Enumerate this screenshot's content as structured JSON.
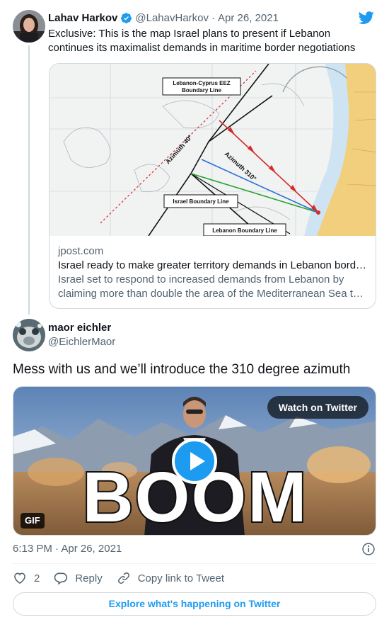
{
  "quoted_tweet": {
    "display_name": "Lahav Harkov",
    "handle": "@LahavHarkov",
    "separator": "·",
    "date": "Apr 26, 2021",
    "text": "Exclusive: This is the map Israel plans to present if Lebanon continues its maximalist demands in maritime border negotiations",
    "link_card": {
      "domain": "jpost.com",
      "title": "Israel ready to make greater territory demands in Lebanon bord…",
      "description": "Israel set to respond to increased demands from Lebanon by claiming more than double the area of the Mediterranean Sea t…",
      "map_labels": {
        "eez": [
          "Lebanon-Cyprus EEZ",
          "Boundary Line"
        ],
        "azimuth_40": "Azimuth 40°",
        "azimuth_310": "Azimuth 310°",
        "israel_line": "Israel Boundary Line",
        "lebanon_line": "Lebanon Boundary Line"
      }
    }
  },
  "main_tweet": {
    "display_name": "maor eichler",
    "handle": "@EichlerMaor",
    "text": "Mess with us and we’ll introduce the 310 degree azimuth",
    "media": {
      "watch_label": "Watch on Twitter",
      "gif_label": "GIF",
      "overlay_text": "BOOM"
    },
    "timestamp": "6:13 PM · Apr 26, 2021"
  },
  "actions": {
    "like_count": "2",
    "reply_label": "Reply",
    "copy_label": "Copy link to Tweet"
  },
  "explore_label": "Explore what's happening on Twitter",
  "icons": {
    "brand": "twitter-bird-icon",
    "verified": "verified-badge-icon",
    "info": "info-icon",
    "like": "heart-icon",
    "reply": "reply-bubble-icon",
    "copy": "link-icon",
    "play": "play-icon"
  },
  "colors": {
    "accent": "#1d9bf0",
    "text": "#0f1419",
    "secondary_text": "#536471",
    "border": "#cfd9de"
  }
}
